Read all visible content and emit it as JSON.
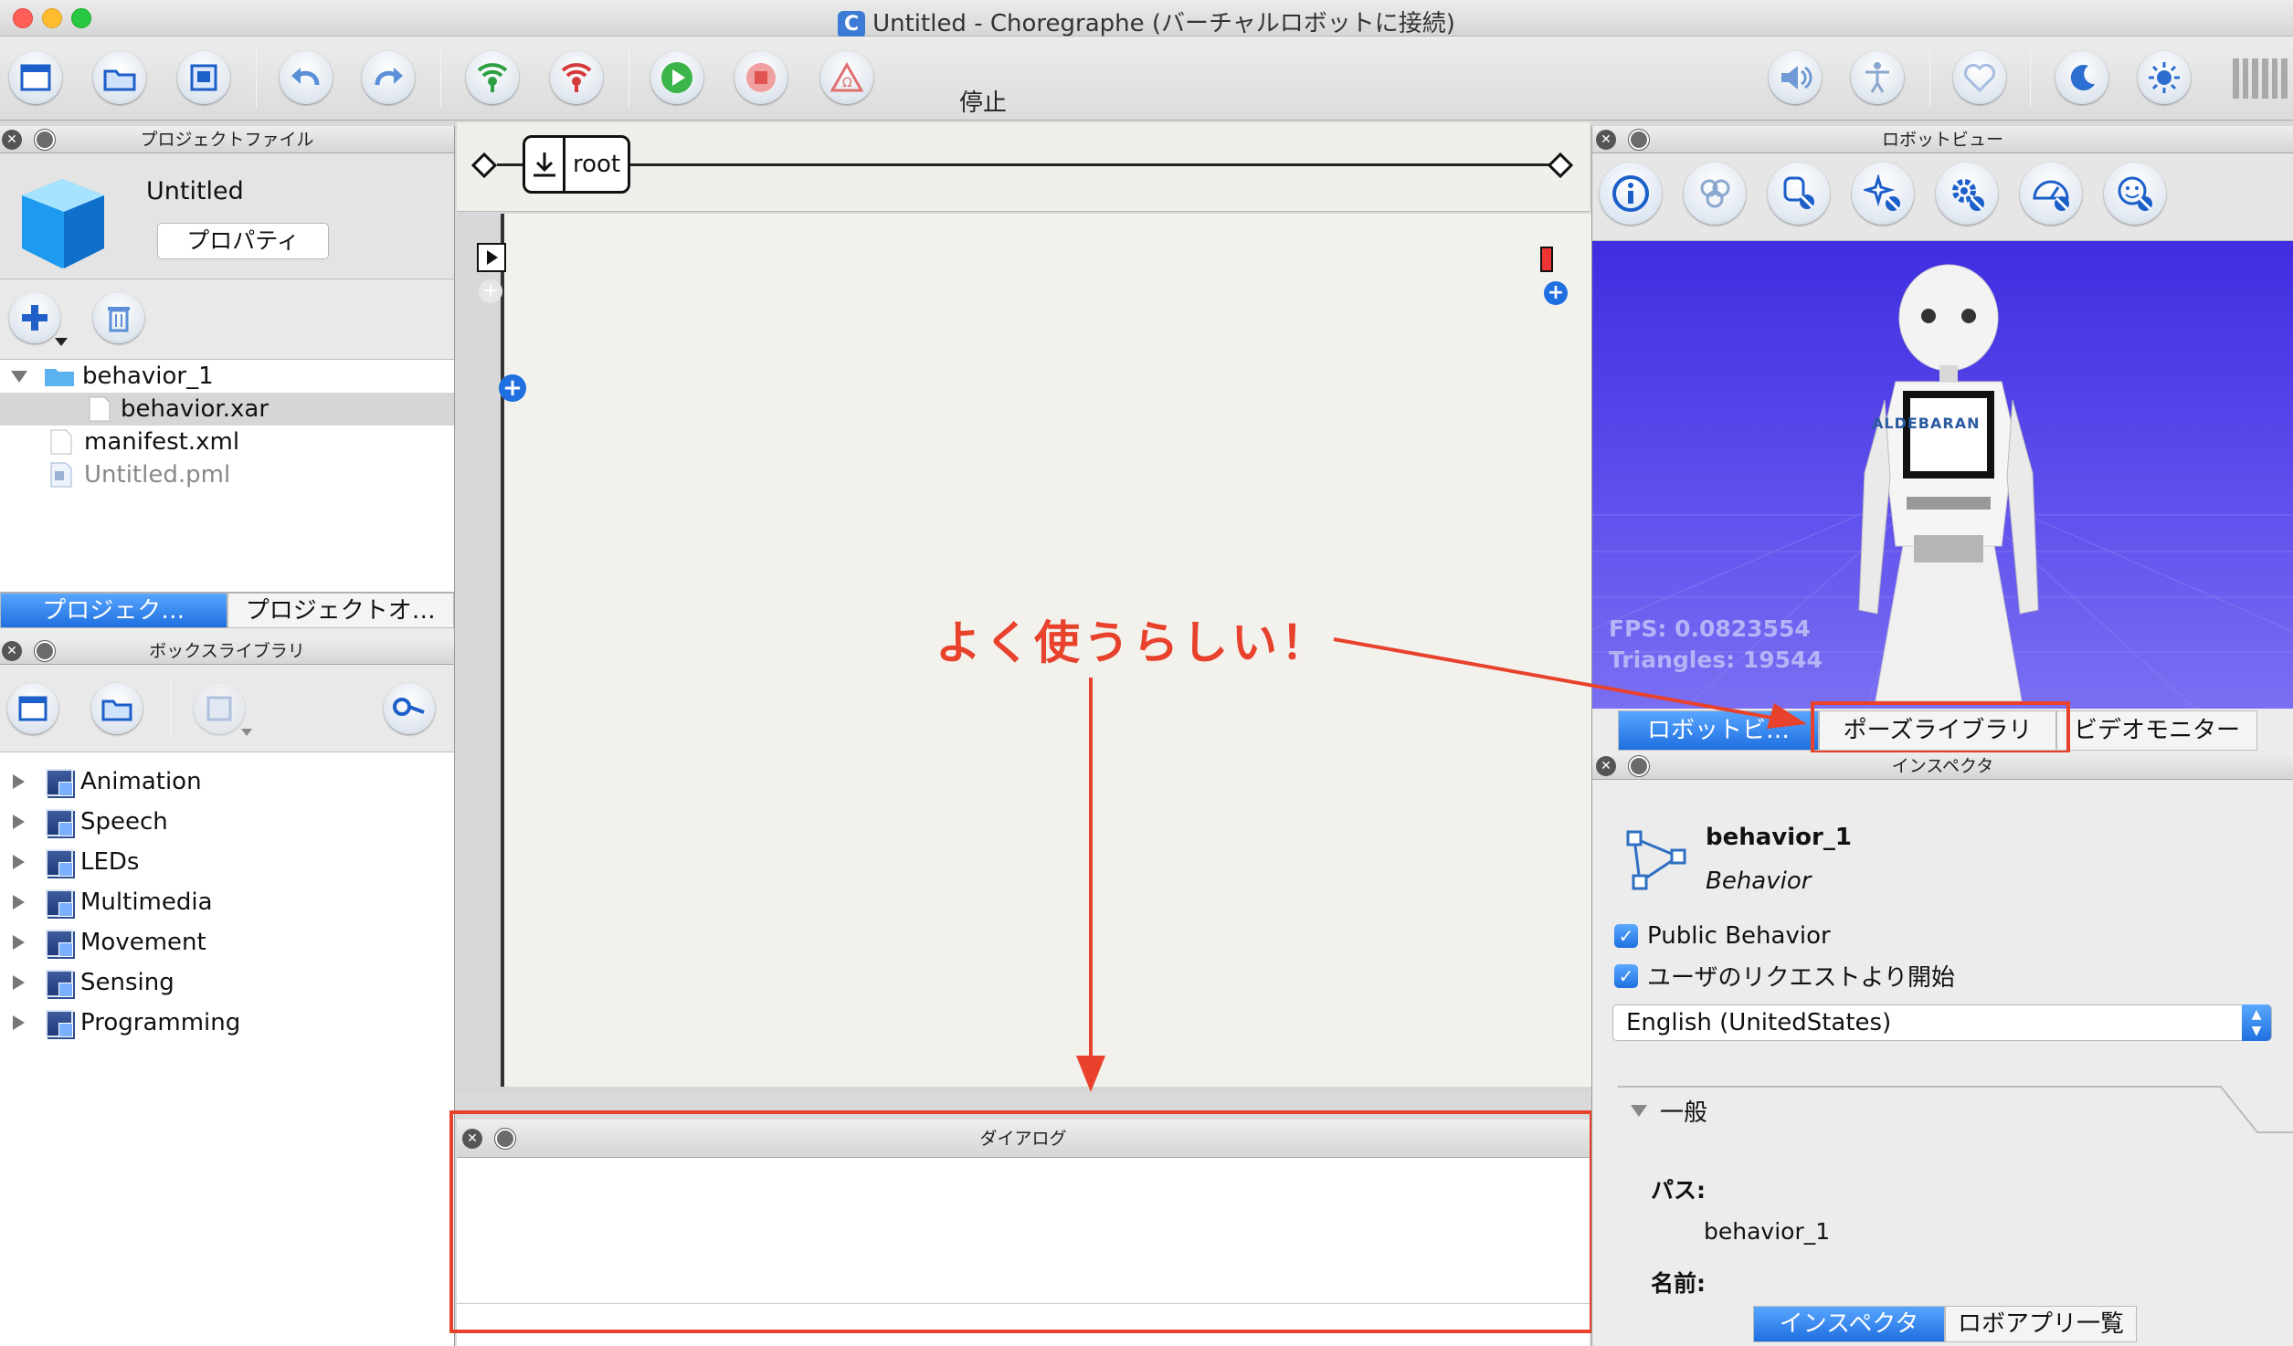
{
  "window": {
    "title": "Untitled - Choregraphe (バーチャルロボットに接続)",
    "app_badge": "C"
  },
  "toolbar": {
    "status_label": "停止"
  },
  "project_panel": {
    "header": "プロジェクトファイル",
    "project_name": "Untitled",
    "properties_button": "プロパティ",
    "files": [
      {
        "label": "behavior_1",
        "type": "folder"
      },
      {
        "label": "behavior.xar",
        "type": "file"
      },
      {
        "label": "manifest.xml",
        "type": "file"
      },
      {
        "label": "Untitled.pml",
        "type": "file"
      }
    ],
    "tabs": [
      "プロジェク…",
      "プロジェクトオ…"
    ]
  },
  "box_library": {
    "header": "ボックスライブラリ",
    "items": [
      "Animation",
      "Speech",
      "LEDs",
      "Multimedia",
      "Movement",
      "Sensing",
      "Programming"
    ]
  },
  "flow": {
    "root_label": "root"
  },
  "dialog_panel": {
    "header": "ダイアログ"
  },
  "robot_view": {
    "header": "ロボットビュー",
    "fps": "FPS: 0.0823554",
    "triangles": "Triangles: 19544",
    "logo_text": "ALDEBARAN",
    "tabs": [
      "ロボットビ…",
      "ポーズライブラリ",
      "ビデオモニター"
    ]
  },
  "inspector": {
    "header": "インスペクタ",
    "name": "behavior_1",
    "type": "Behavior",
    "public_behavior": "Public Behavior",
    "user_request": "ユーザのリクエストより開始",
    "language": "English (UnitedStates)",
    "section_general": "一般",
    "path_label": "パス:",
    "path_value": "behavior_1",
    "name_label": "名前:",
    "tabs": [
      "インスペクタ",
      "ロボアプリ一覧"
    ]
  },
  "annotation": {
    "text": "よく使うらしい！",
    "color": "#e8412c"
  }
}
